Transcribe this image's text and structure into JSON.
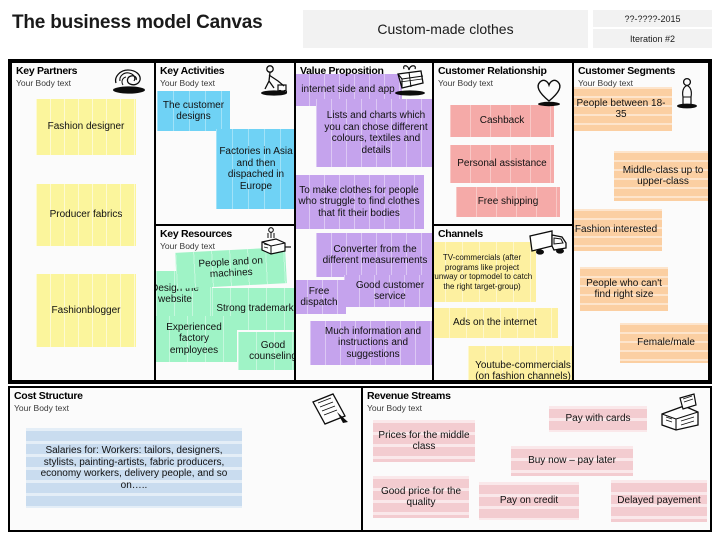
{
  "header": {
    "doc_title": "The business model Canvas",
    "project_title": "Custom-made clothes",
    "date": "??-????-2015",
    "iteration": "Iteration #2"
  },
  "body_text_placeholder": "Your Body text",
  "colors": {
    "yellow": "#fbf59c",
    "blue": "#6fd2f5",
    "green": "#9ff3c6",
    "purple": "#c5a3ed",
    "pink": "#f5aaa8",
    "orange": "#fbcfa2",
    "light_yellow": "#fdf0a0",
    "steel_blue": "#c9dcef",
    "rose": "#f3ccd0",
    "header_bg": "#f2f2f2",
    "border": "#000000"
  },
  "sections": {
    "key_partners": {
      "title": "Key Partners",
      "subtitle": "Your Body text",
      "icon": "handshake-icon",
      "notes": [
        {
          "text": "Fashion designer"
        },
        {
          "text": "Producer fabrics"
        },
        {
          "text": "Fashionblogger"
        }
      ]
    },
    "key_activities": {
      "title": "Key Activities",
      "subtitle": "Your Body text",
      "icon": "worker-icon",
      "notes": [
        {
          "text": "The customer designs"
        },
        {
          "text": "Factories in Asia and then dispached in Europe"
        }
      ]
    },
    "key_resources": {
      "title": "Key Resources",
      "subtitle": "Your Body text",
      "icon": "machine-icon",
      "notes": [
        {
          "text": "Design the website"
        },
        {
          "text": "People and on machines"
        },
        {
          "text": "Strong trademark"
        },
        {
          "text": "Experienced factory employees"
        },
        {
          "text": "Good counseling"
        }
      ]
    },
    "value_proposition": {
      "title": "Value Proposition",
      "subtitle": "Your Body text",
      "icon": "gift-icon",
      "notes": [
        {
          "text": "internet side and app"
        },
        {
          "text": "Lists and charts which you can chose different colours, textiles and details"
        },
        {
          "text": "To make clothes for people who struggle to find clothes that fit their bodies"
        },
        {
          "text": "Converter from the different measurements"
        },
        {
          "text": "Good customer service"
        },
        {
          "text": "Free dispatch"
        },
        {
          "text": "Much information and instructions and suggestions"
        }
      ]
    },
    "customer_relationship": {
      "title": "Customer Relationship",
      "subtitle": "Your Body text",
      "icon": "heart-icon",
      "notes": [
        {
          "text": "Cashback"
        },
        {
          "text": "Personal assistance"
        },
        {
          "text": "Free shipping"
        }
      ]
    },
    "channels": {
      "title": "Channels",
      "subtitle": "Your Body text",
      "icon": "truck-icon",
      "notes": [
        {
          "text": "TV-commercials (after programs like project runway or topmodel to catch the right target-group)"
        },
        {
          "text": "Ads on the internet"
        },
        {
          "text": "Youtube-commercials (on fashion channels)"
        }
      ]
    },
    "customer_segments": {
      "title": "Customer Segments",
      "subtitle": "Your Body text",
      "icon": "person-icon",
      "notes": [
        {
          "text": "People between 18-35"
        },
        {
          "text": "Middle-class up to upper-class"
        },
        {
          "text": "Fashion interested"
        },
        {
          "text": "People who can't find right size"
        },
        {
          "text": "Female/male"
        }
      ]
    },
    "cost_structure": {
      "title": "Cost Structure",
      "subtitle": "Your Body text",
      "icon": "invoice-icon",
      "notes": [
        {
          "text": "Salaries for: Workers: tailors, designers, stylists, painting-artists, fabric producers, economy workers, delivery people, and so on….."
        }
      ]
    },
    "revenue_streams": {
      "title": "Revenue Streams",
      "subtitle": "Your Body text",
      "icon": "cash-register-icon",
      "notes": [
        {
          "text": "Prices for the middle class"
        },
        {
          "text": "Pay with cards"
        },
        {
          "text": "Buy now – pay later"
        },
        {
          "text": "Good price for the quality"
        },
        {
          "text": "Pay on credit"
        },
        {
          "text": "Delayed payement"
        }
      ]
    }
  }
}
